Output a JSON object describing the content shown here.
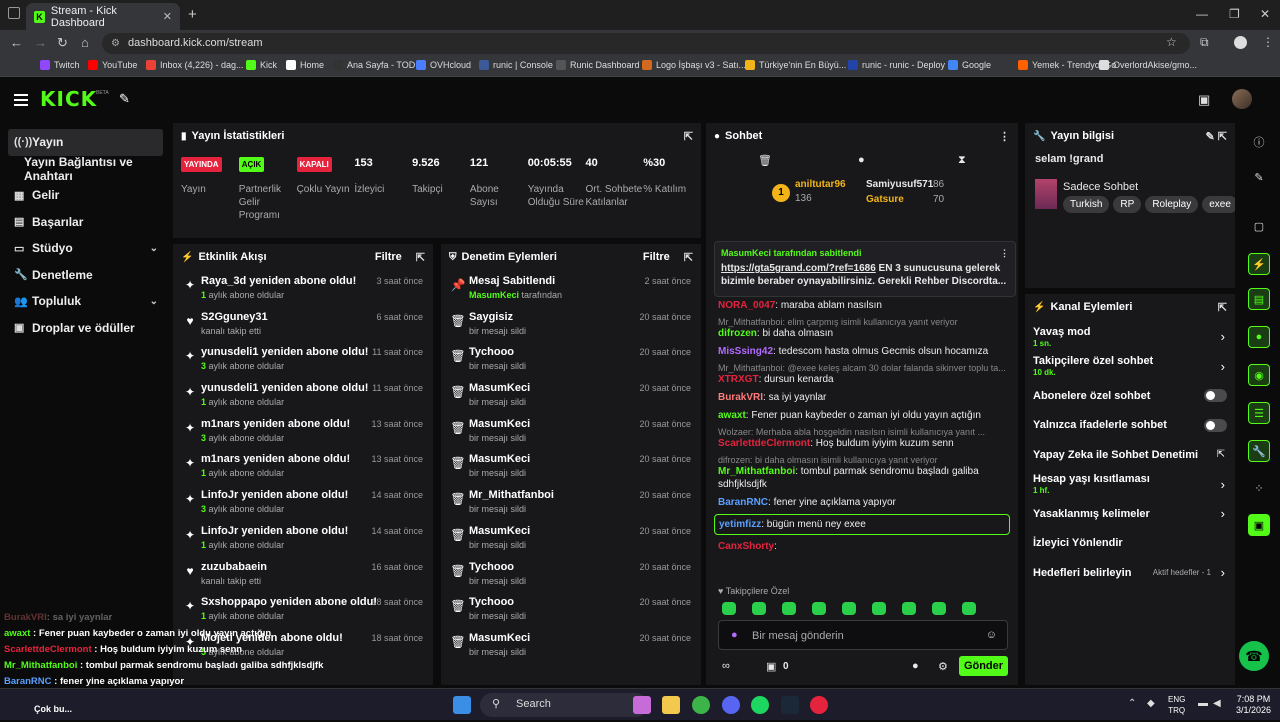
{
  "browser": {
    "tab_title": "Stream - Kick Dashboard",
    "url": "dashboard.kick.com/stream",
    "bookmarks": [
      "Twitch",
      "YouTube",
      "Inbox (4,226) - dag...",
      "Kick",
      "Home",
      "Ana Sayfa - TOD",
      "OVHcloud",
      "runic | Console",
      "Runic Dashboard",
      "Logo İşbaşı v3 - Satı...",
      "Türkiye'nin En Büyü...",
      "runic - runic - Deploy",
      "Google",
      "Yemek - Trendyol Go",
      "OverlordAkise/gmo..."
    ]
  },
  "header": {
    "logo": "KICK",
    "beta": "BETA"
  },
  "sidebar": {
    "items": [
      {
        "label": "Yayın",
        "icon": "broadcast-icon"
      },
      {
        "label": "Yayın Bağlantısı ve Anahtarı",
        "icon": ""
      },
      {
        "label": "Gelir",
        "icon": "revenue-icon"
      },
      {
        "label": "Başarılar",
        "icon": "achievements-icon"
      },
      {
        "label": "Stüdyo",
        "icon": "studio-icon",
        "chevron": true
      },
      {
        "label": "Denetleme",
        "icon": "wrench-icon"
      },
      {
        "label": "Topluluk",
        "icon": "community-icon",
        "chevron": true
      },
      {
        "label": "Droplar ve ödüller",
        "icon": "gift-icon"
      }
    ]
  },
  "stats": {
    "title": "Yayın İstatistikleri",
    "items": [
      {
        "value": "YAYINDA",
        "label": "Yayın",
        "badge": "#e5233d"
      },
      {
        "value": "AÇIK",
        "label": "Partnerlik Gelir Programı",
        "badge": "#53fc18"
      },
      {
        "value": "KAPALI",
        "label": "Çoklu Yayın",
        "badge": "#e5233d"
      },
      {
        "value": "153",
        "label": "İzleyici"
      },
      {
        "value": "9.526",
        "label": "Takipçi"
      },
      {
        "value": "121",
        "label": "Abone Sayısı"
      },
      {
        "value": "00:05:55",
        "label": "Yayında Olduğu Süre"
      },
      {
        "value": "40",
        "label": "Ort. Sohbete Katılanlar"
      },
      {
        "value": "%30",
        "label": "% Katılım"
      }
    ]
  },
  "activity": {
    "title": "Etkinlik Akışı",
    "filter": "Filtre",
    "items": [
      {
        "name": "Raya_3d yeniden abone oldu!",
        "sub": "1",
        "subtext": " aylık abone oldular",
        "time": "3 saat önce",
        "icon": "sparkle-icon"
      },
      {
        "name": "S2Gguney31",
        "sub": "",
        "subtext": "kanalı takip etti",
        "time": "6 saat önce",
        "icon": "heart-icon"
      },
      {
        "name": "yunusdeli1 yeniden abone oldu!",
        "sub": "3",
        "subtext": " aylık abone oldular",
        "time": "11 saat önce",
        "icon": "sparkle-icon"
      },
      {
        "name": "yunusdeli1 yeniden abone oldu!",
        "sub": "1",
        "subtext": " aylık abone oldular",
        "time": "11 saat önce",
        "icon": "sparkle-icon"
      },
      {
        "name": "m1nars yeniden abone oldu!",
        "sub": "3",
        "subtext": " aylık abone oldular",
        "time": "13 saat önce",
        "icon": "sparkle-icon"
      },
      {
        "name": "m1nars yeniden abone oldu!",
        "sub": "1",
        "subtext": " aylık abone oldular",
        "time": "13 saat önce",
        "icon": "sparkle-icon"
      },
      {
        "name": "LinfoJr yeniden abone oldu!",
        "sub": "3",
        "subtext": " aylık abone oldular",
        "time": "14 saat önce",
        "icon": "sparkle-icon"
      },
      {
        "name": "LinfoJr yeniden abone oldu!",
        "sub": "1",
        "subtext": " aylık abone oldular",
        "time": "14 saat önce",
        "icon": "sparkle-icon"
      },
      {
        "name": "zuzubabaein",
        "sub": "",
        "subtext": "kanalı takip etti",
        "time": "16 saat önce",
        "icon": "heart-icon"
      },
      {
        "name": "Sxshoppapo yeniden abone oldu!",
        "sub": "1",
        "subtext": " aylık abone oldular",
        "time": "18 saat önce",
        "icon": "sparkle-icon"
      },
      {
        "name": "Mojeti yeniden abone oldu!",
        "sub": "5",
        "subtext": " aylık abone oldular",
        "time": "18 saat önce",
        "icon": "sparkle-icon"
      }
    ]
  },
  "moderation": {
    "title": "Denetim Eylemleri",
    "filter": "Filtre",
    "items": [
      {
        "name": "Mesaj Sabitlendi",
        "sub": "MasumKeci",
        "subtext": " tarafından",
        "time": "2 saat önce",
        "icon": "pin-icon"
      },
      {
        "name": "Saygisiz",
        "sub": "",
        "subtext": "bir mesajı sildi",
        "time": "20 saat önce",
        "icon": "trash-icon"
      },
      {
        "name": "Tychooo",
        "sub": "",
        "subtext": "bir mesajı sildi",
        "time": "20 saat önce",
        "icon": "trash-icon"
      },
      {
        "name": "MasumKeci",
        "sub": "",
        "subtext": "bir mesajı sildi",
        "time": "20 saat önce",
        "icon": "trash-icon"
      },
      {
        "name": "MasumKeci",
        "sub": "",
        "subtext": "bir mesajı sildi",
        "time": "20 saat önce",
        "icon": "trash-icon"
      },
      {
        "name": "MasumKeci",
        "sub": "",
        "subtext": "bir mesajı sildi",
        "time": "20 saat önce",
        "icon": "trash-icon"
      },
      {
        "name": "Mr_Mithatfanboi",
        "sub": "",
        "subtext": "bir mesajı sildi",
        "time": "20 saat önce",
        "icon": "trash-icon"
      },
      {
        "name": "MasumKeci",
        "sub": "",
        "subtext": "bir mesajı sildi",
        "time": "20 saat önce",
        "icon": "trash-icon"
      },
      {
        "name": "Tychooo",
        "sub": "",
        "subtext": "bir mesajı sildi",
        "time": "20 saat önce",
        "icon": "trash-icon"
      },
      {
        "name": "Tychooo",
        "sub": "",
        "subtext": "bir mesajı sildi",
        "time": "20 saat önce",
        "icon": "trash-icon"
      },
      {
        "name": "MasumKeci",
        "sub": "",
        "subtext": "bir mesajı sildi",
        "time": "20 saat önce",
        "icon": "trash-icon"
      }
    ]
  },
  "chat": {
    "title": "Sohbet",
    "leaders": {
      "first_name": "aniltutar96",
      "first_value": "136",
      "second_name": "Samiyusuf571",
      "second_value": "86",
      "third_name": "Gatsure",
      "third_value": "70",
      "rank": "1"
    },
    "pinned": {
      "by": "MasumKeci tarafından sabitlendi",
      "link": "https://gta5grand.com/?ref=1686",
      "text": " EN 3 sunucusuna gelerek bizimle beraber oynayabilirsiniz. Gerekli Rehber Discordta..."
    },
    "messages": [
      {
        "reply": "",
        "user": "NORA_0047",
        "color": "#e5233d",
        "text": ": maraba ablam nasılsın"
      },
      {
        "reply": "Mr_Mithatfanboi: elim çarpmış isimli kullanıcıya yanıt veriyor",
        "user": "difrozen",
        "color": "#53fc18",
        "text": ": bi daha olmasın"
      },
      {
        "reply": "",
        "user": "MisSsing42",
        "color": "#b36bff",
        "text": ": tedescom hasta olmus Gecmis olsun hocamıza"
      },
      {
        "reply": "Mr_Mithatfanboi: @exee keleş alcam 30 dolar falanda sikinver toplu ta...",
        "user": "XTRXGT",
        "color": "#e5233d",
        "text": ": dursun kenarda"
      },
      {
        "reply": "",
        "user": "BurakVRI",
        "color": "#ff7a7a",
        "text": ": sa iyi yaynlar"
      },
      {
        "reply": "",
        "user": "awaxt",
        "color": "#53fc18",
        "text": ": Fener puan kaybeder o zaman iyi oldu yayın açtığın"
      },
      {
        "reply": "Wolzaer: Merhaba abla hoşgeldin nasılsın isimli kullanıcıya yanıt ...",
        "user": "ScarlettdeClermont",
        "color": "#e5233d",
        "text": ": Hoş buldum iyiyim kuzum senn"
      },
      {
        "reply": "difrozen: bi daha olmasın isimli kullanıcıya yanıt veriyor",
        "user": "Mr_Mithatfanboi",
        "color": "#53fc18",
        "text": ": tombul parmak sendromu başladı galiba sdhfjklsdjfk"
      },
      {
        "reply": "",
        "user": "BaranRNC",
        "color": "#5aa0ff",
        "text": ": fener yine açıklama yapıyor"
      },
      {
        "reply": "",
        "user": "yetimfizz",
        "color": "#5aa0ff",
        "text": ": bügün menü ney exee"
      },
      {
        "reply": "",
        "user": "CanxShorty",
        "color": "#e5233d",
        "text": ":"
      }
    ],
    "emote_label": "Takipçilere Özel",
    "placeholder": "Bir mesaj gönderin",
    "points": "0",
    "send": "Gönder"
  },
  "stream_info": {
    "title": "Yayın bilgisi",
    "stream_title": "selam !grand",
    "category": "Sadece Sohbet",
    "tags": [
      "Turkish",
      "RP",
      "Roleplay",
      "exee"
    ]
  },
  "channel": {
    "title": "Kanal Eylemleri",
    "items": [
      {
        "label": "Yavaş mod",
        "sub": "1 sn.",
        "ctrl": "arrow"
      },
      {
        "label": "Takipçilere özel sohbet",
        "sub": "10 dk.",
        "ctrl": "arrow"
      },
      {
        "label": "Abonelere özel sohbet",
        "sub": "",
        "ctrl": "toggle"
      },
      {
        "label": "Yalnızca ifadelerle sohbet",
        "sub": "",
        "ctrl": "toggle"
      },
      {
        "label": "Yapay Zeka ile Sohbet Denetimi",
        "sub": "",
        "ctrl": "ext"
      },
      {
        "label": "Hesap yaşı kısıtlaması",
        "sub": "1 hf.",
        "ctrl": "arrow"
      },
      {
        "label": "Yasaklanmış kelimeler",
        "sub": "",
        "ctrl": "arrow"
      },
      {
        "label": "İzleyici Yönlendir",
        "sub": "",
        "ctrl": ""
      },
      {
        "label": "Hedefleri belirleyin",
        "sub": "",
        "ctrl": "arrow",
        "extra": "Aktif hedefler - 1"
      }
    ]
  },
  "overlay": [
    {
      "user": "BurakVRI",
      "color": "#ff7a7a",
      "text": ": sa iyi yaynlar"
    },
    {
      "user": "awaxt",
      "color": "#53fc18",
      "text": " : Fener puan kaybeder o zaman iyi oldu yayın açtığın"
    },
    {
      "user": "ScarlettdeClermont",
      "color": "#e5233d",
      "text": " : Hoş buldum iyiyim kuzum senn"
    },
    {
      "user": "Mr_Mithatfanboi",
      "color": "#53fc18",
      "text": " : tombul parmak sendromu başladı galiba sdhfjklsdjfk"
    },
    {
      "user": "BaranRNC",
      "color": "#5aa0ff",
      "text": " : fener yine açıklama yapıyor"
    },
    {
      "user": "yetimfizz",
      "color": "#5aa0ff",
      "text": " : bügün menü ney exee"
    },
    {
      "user": "CanxShorty",
      "color": "#e5233d",
      "text": " :"
    }
  ],
  "taskbar": {
    "search": "Search",
    "lang1": "ENG",
    "lang2": "TRQ",
    "time": "7:08 PM",
    "date": "3/1/2026",
    "overlay_note": "Çok bu..."
  }
}
